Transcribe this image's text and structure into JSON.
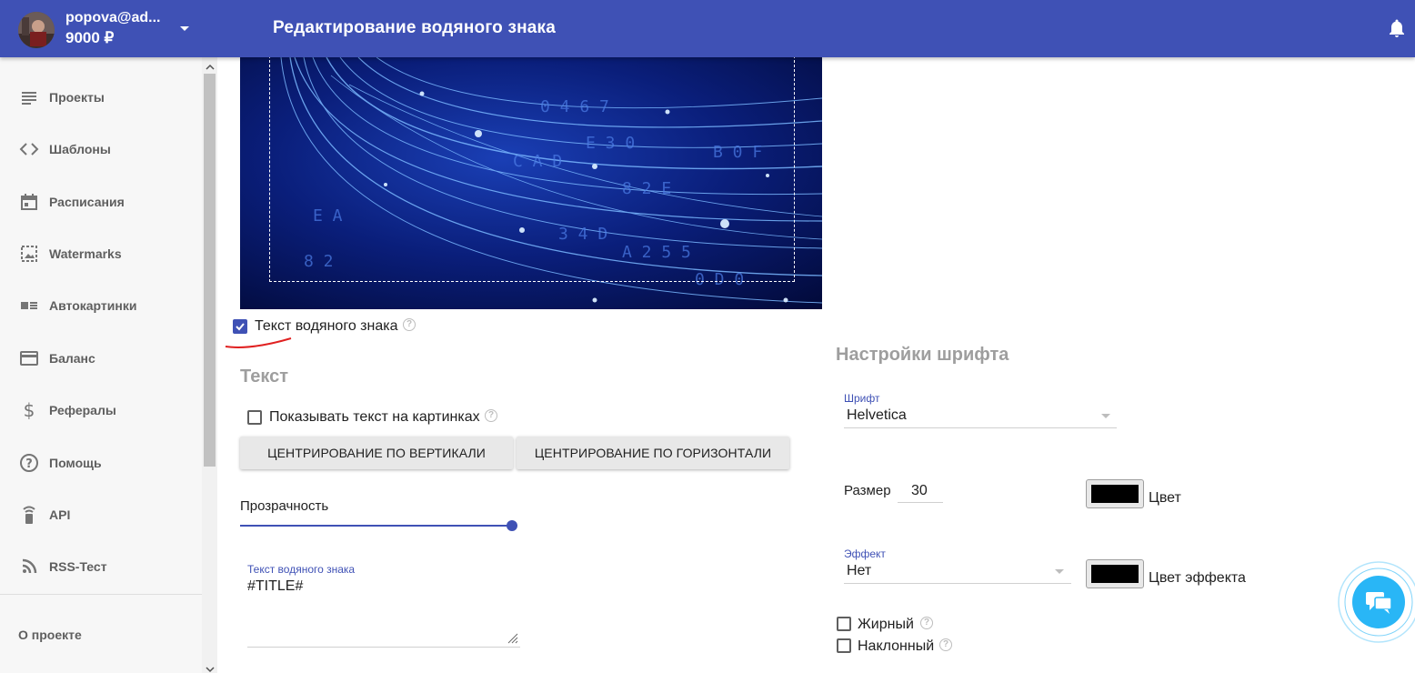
{
  "header": {
    "user_email": "popova@ad...",
    "user_balance": "9000 ₽",
    "page_title": "Редактирование водяного знака"
  },
  "sidebar": {
    "items": [
      {
        "label": "Проекты",
        "icon": "list-icon"
      },
      {
        "label": "Шаблоны",
        "icon": "code-icon"
      },
      {
        "label": "Расписания",
        "icon": "calendar-icon"
      },
      {
        "label": "Watermarks",
        "icon": "image-frame-icon"
      },
      {
        "label": "Автокартинки",
        "icon": "image-text-icon"
      },
      {
        "label": "Баланс",
        "icon": "credit-card-icon"
      },
      {
        "label": "Рефералы",
        "icon": "dollar-icon"
      },
      {
        "label": "Помощь",
        "icon": "help-circle-icon"
      },
      {
        "label": "API",
        "icon": "remote-icon"
      },
      {
        "label": "RSS-Тест",
        "icon": "rss-icon"
      }
    ],
    "about": "О проекте"
  },
  "watermark": {
    "text_toggle_label": "Текст водяного знака",
    "text_toggle_checked": true
  },
  "text_section": {
    "title": "Текст",
    "show_text_label": "Показывать текст на картинках",
    "show_text_checked": false,
    "center_vertical_label": "ЦЕНТРИРОВАНИЕ ПО ВЕРТИКАЛИ",
    "center_horizontal_label": "ЦЕНТРИРОВАНИЕ ПО ГОРИЗОНТАЛИ",
    "opacity_label": "Прозрачность",
    "opacity_value": 1.0,
    "watermark_text_label": "Текст водяного знака",
    "watermark_text_value": "#TITLE#"
  },
  "font_section": {
    "title": "Настройки шрифта",
    "font_label": "Шрифт",
    "font_value": "Helvetica",
    "size_label": "Размер",
    "size_value": "30",
    "color_label": "Цвет",
    "color_value": "#000000",
    "effect_label": "Эффект",
    "effect_value": "Нет",
    "effect_color_label": "Цвет эффекта",
    "effect_color_value": "#000000",
    "bold_label": "Жирный",
    "bold_checked": false,
    "italic_label": "Наклонный",
    "italic_checked": false
  },
  "colors": {
    "primary": "#3f51b5",
    "chat_accent": "#29b6f6"
  }
}
